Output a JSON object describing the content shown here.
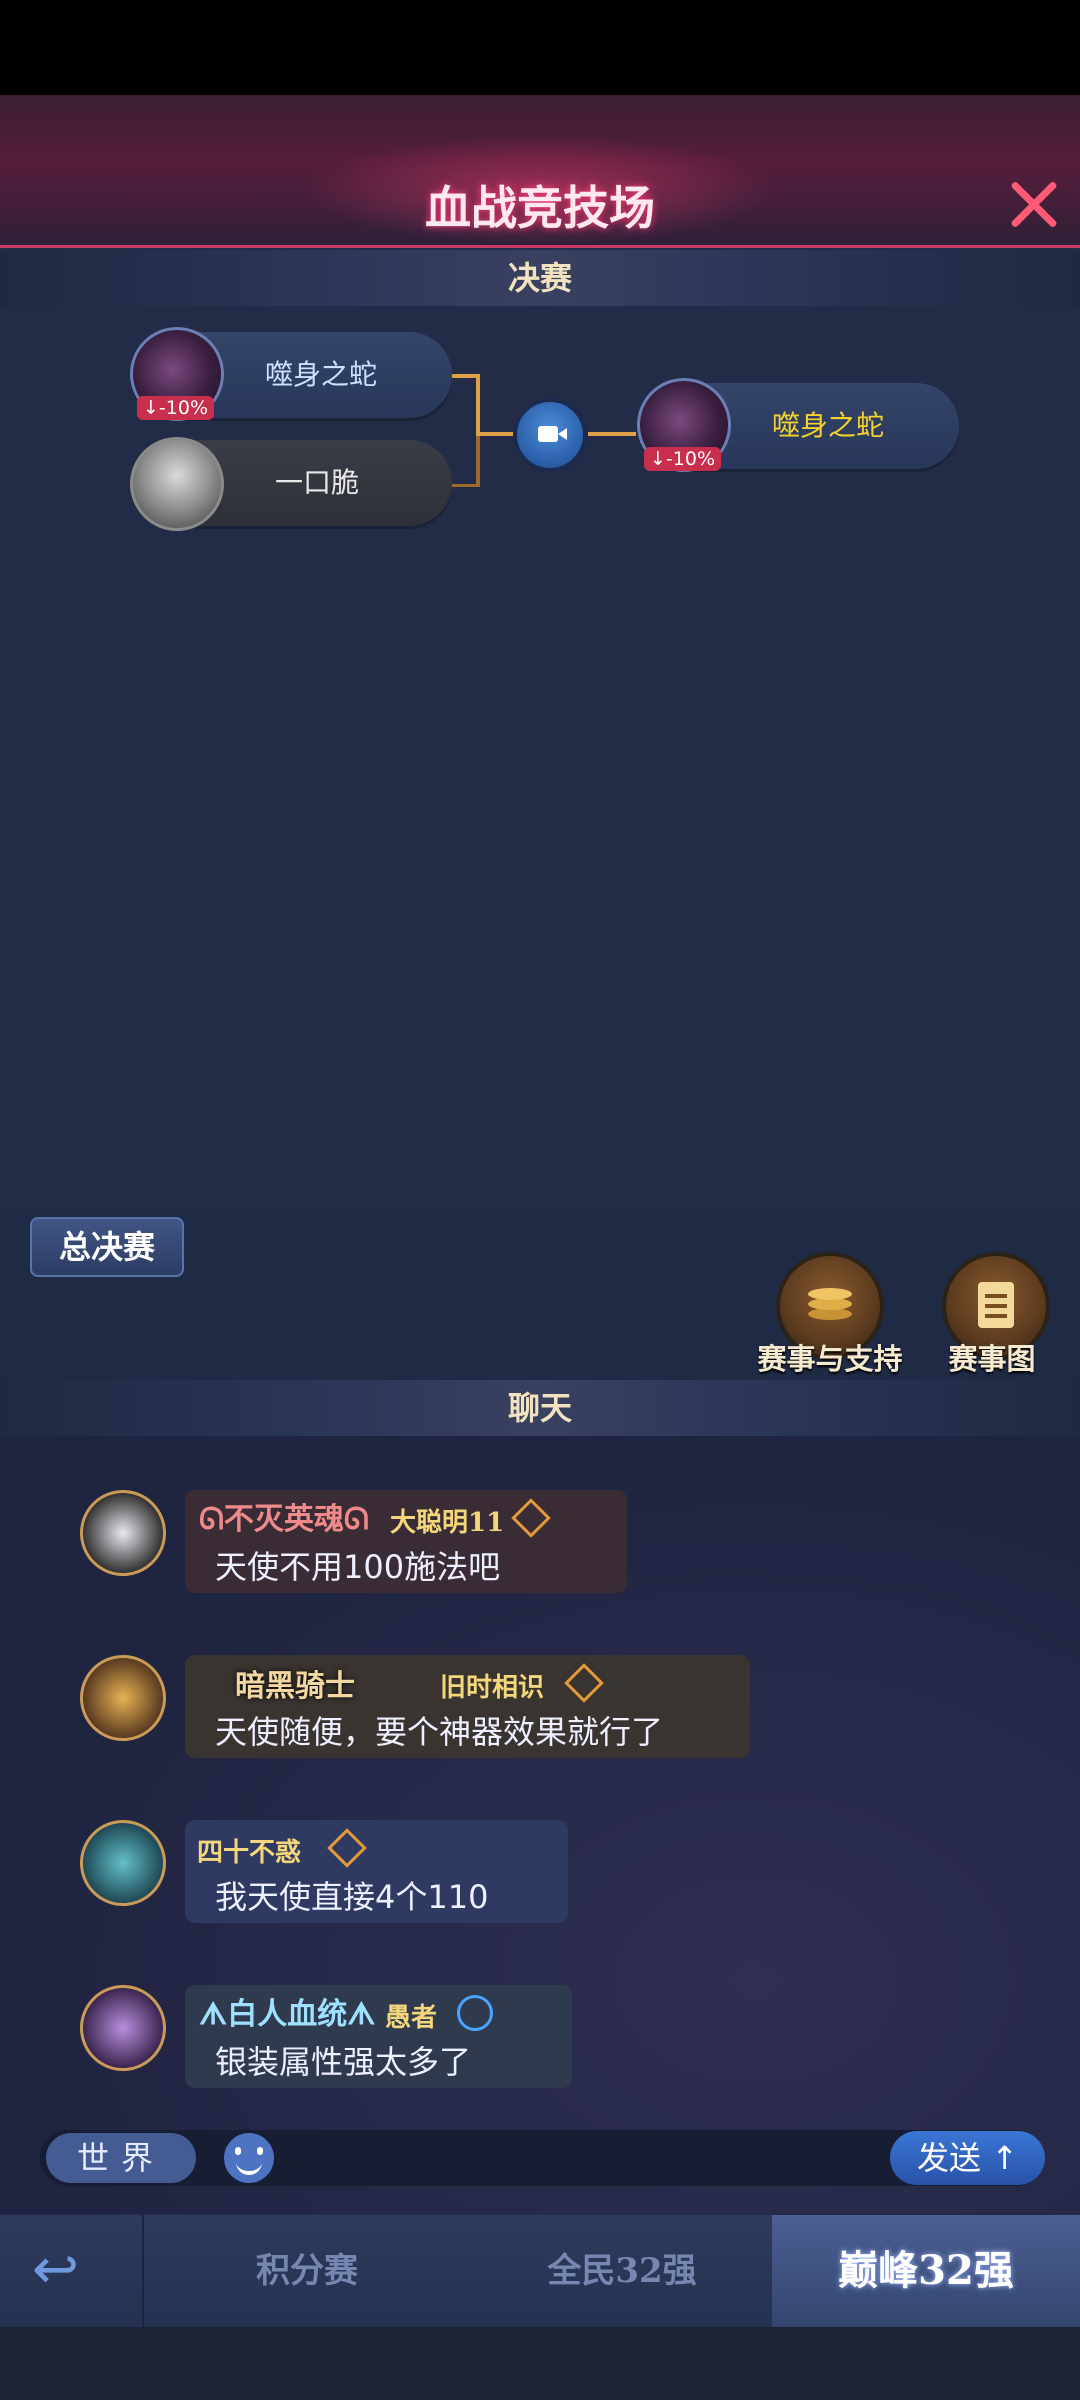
{
  "header": {
    "title": "血战竞技场",
    "close_icon": "close-icon"
  },
  "final_section": {
    "label": "决赛"
  },
  "bracket": {
    "players": [
      {
        "name": "噬身之蛇",
        "badge": "-10%"
      },
      {
        "name": "一口脆"
      }
    ],
    "winner": {
      "name": "噬身之蛇",
      "badge": "-10%"
    },
    "replay_icon": "video-camera-icon"
  },
  "stage": {
    "tab_label": "总决赛",
    "buttons": [
      {
        "label": "赛事与支持",
        "icon": "coins-icon"
      },
      {
        "label": "赛事图",
        "icon": "clipboard-icon"
      }
    ]
  },
  "chat_section": {
    "label": "聊天"
  },
  "chat": {
    "messages": [
      {
        "title": "不灭英魂",
        "user": "大聪明11",
        "text": "天使不用100施法吧"
      },
      {
        "title": "暗黑骑士",
        "user": "旧时相识",
        "text": "天使随便，要个神器效果就行了"
      },
      {
        "title": "",
        "user": "四十不惑",
        "text": "我天使直接4个110"
      },
      {
        "title": "白人血统",
        "user": "愚者",
        "text": "银装属性强太多了"
      }
    ]
  },
  "input": {
    "channel": "世界",
    "send": "发送"
  },
  "nav": {
    "tabs": [
      {
        "label": "积分赛"
      },
      {
        "label": "全民32强"
      },
      {
        "label": "巅峰32强"
      }
    ],
    "active_index": 2
  },
  "colors": {
    "accent": "#c73a66",
    "gold_text": "#f5d22e",
    "link_blue": "#3b76d6"
  }
}
